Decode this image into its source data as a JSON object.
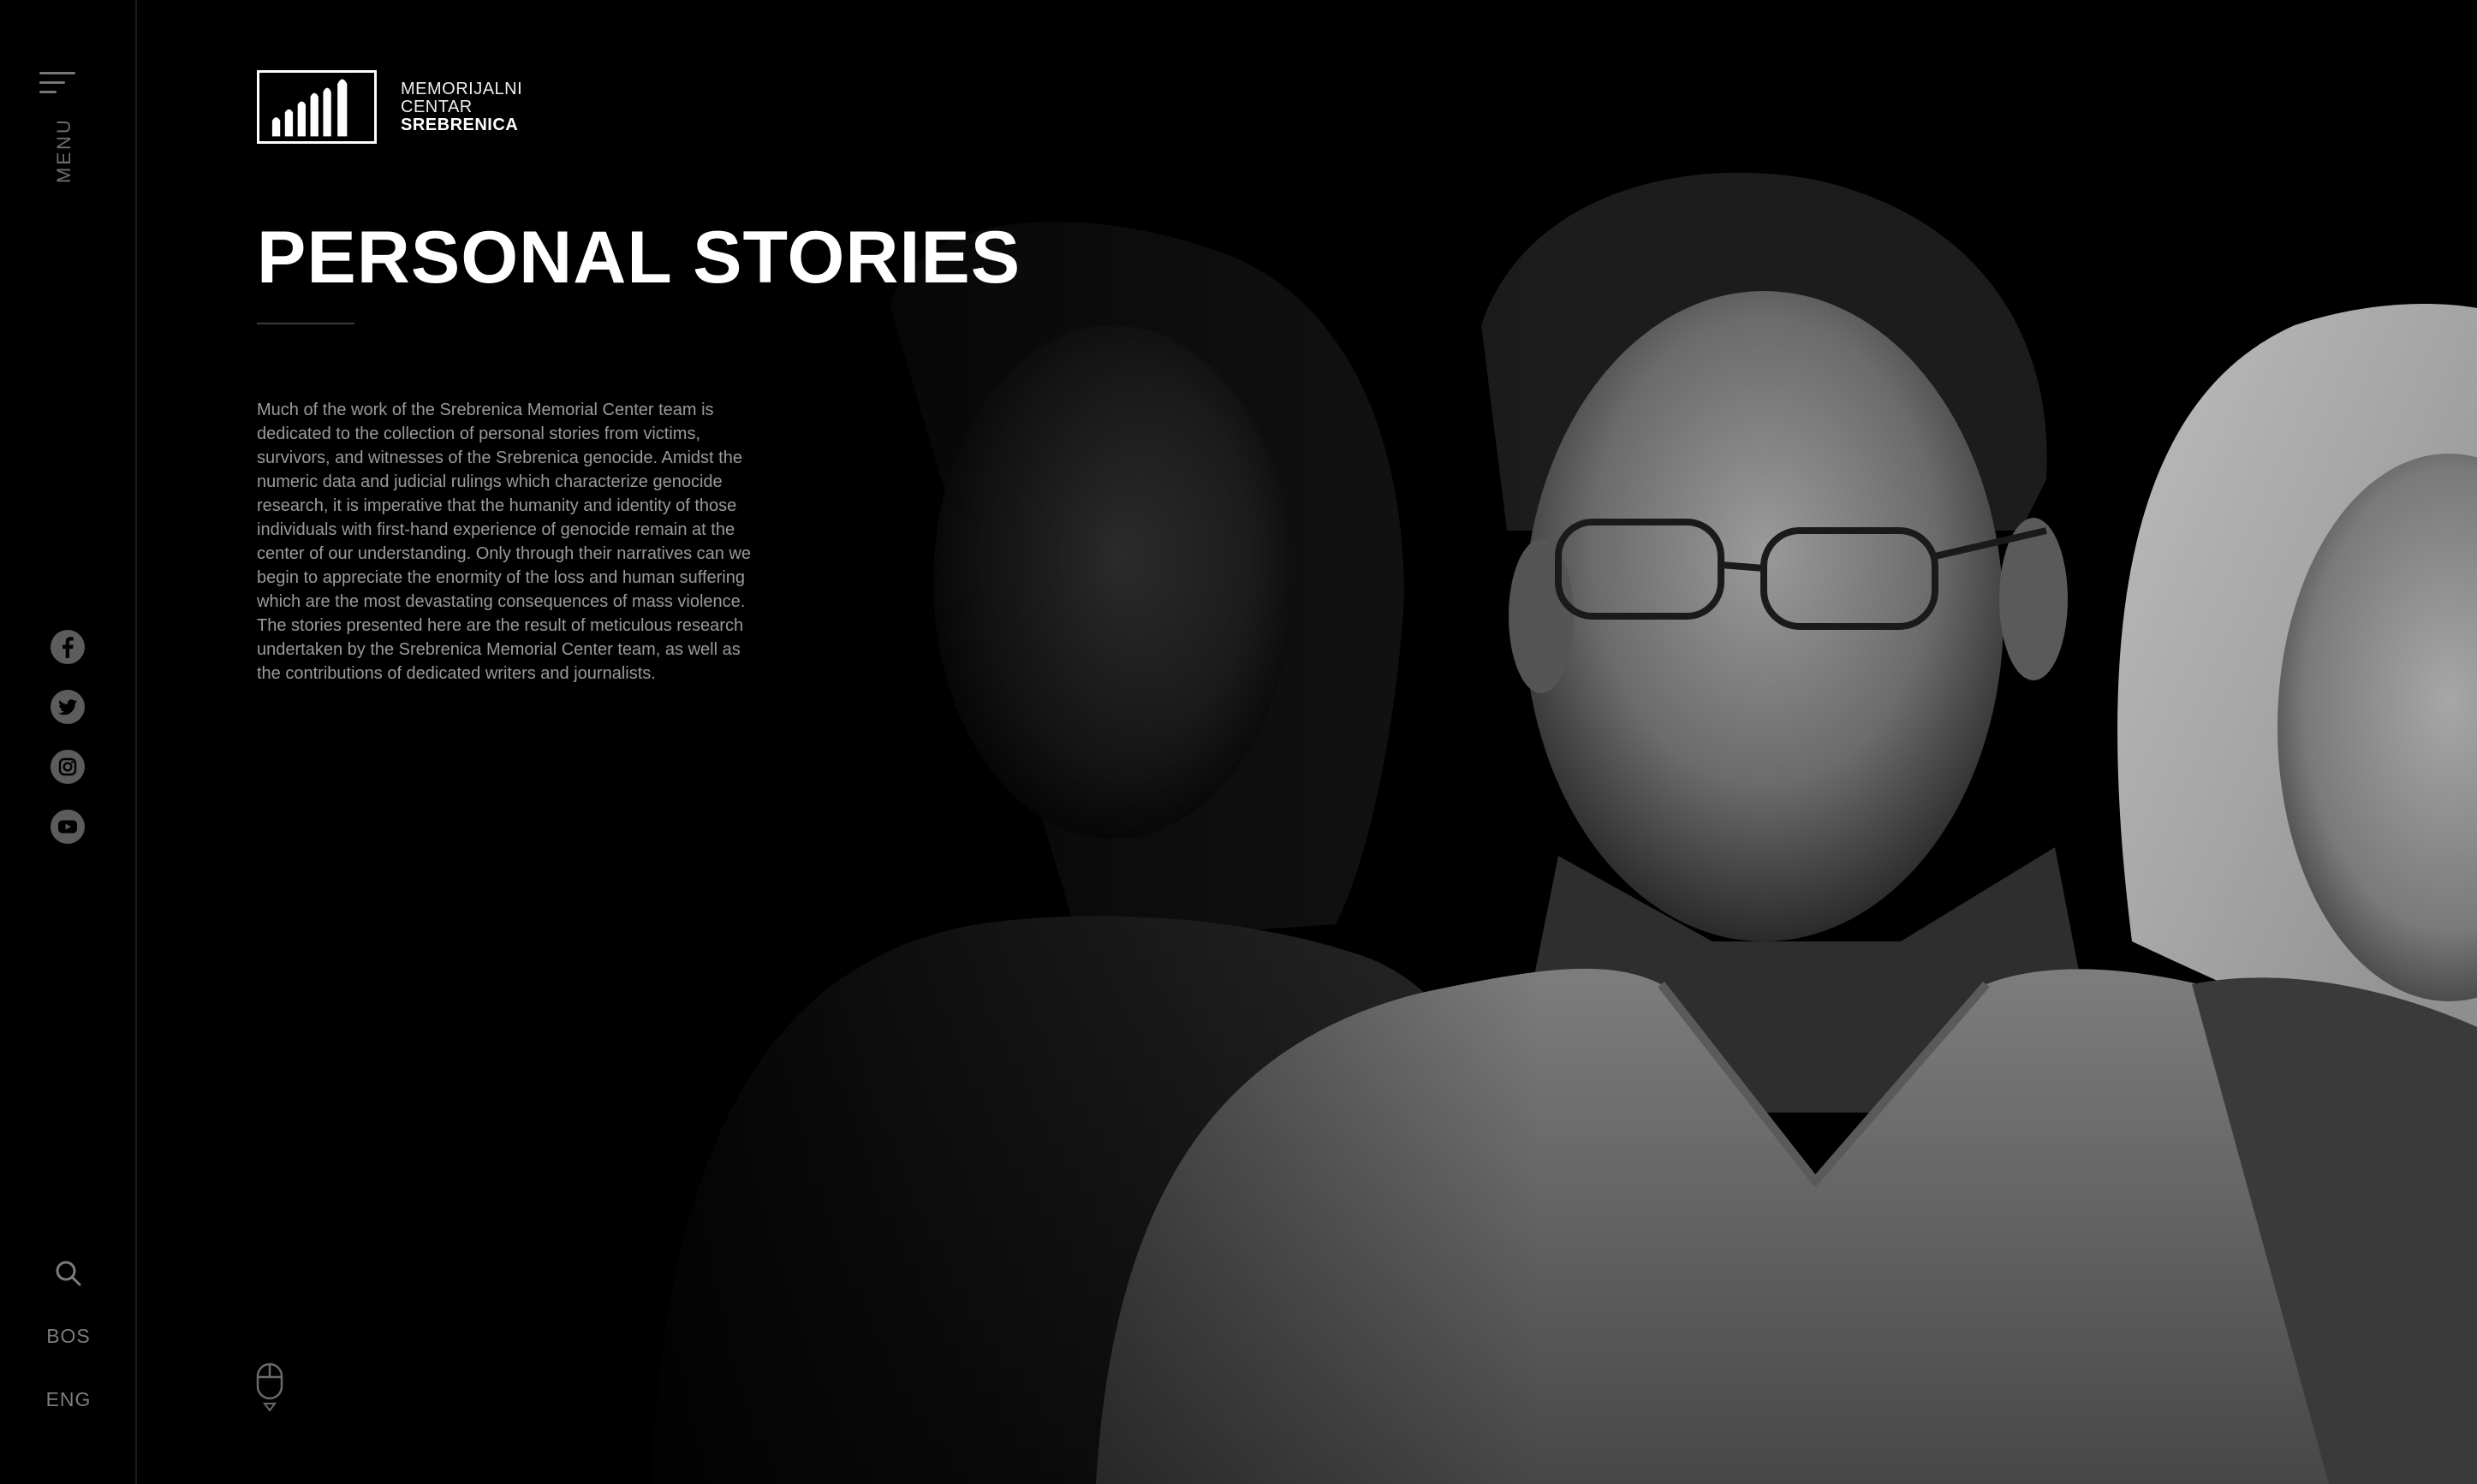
{
  "sidebar": {
    "menu_label": "MENU",
    "social": [
      {
        "name": "facebook-icon"
      },
      {
        "name": "twitter-icon"
      },
      {
        "name": "instagram-icon"
      },
      {
        "name": "youtube-icon"
      }
    ],
    "languages": [
      "BOS",
      "ENG"
    ]
  },
  "logo": {
    "line1": "MEMORIJALNI",
    "line2": "CENTAR",
    "line3": "SREBRENICA"
  },
  "page": {
    "title": "PERSONAL STORIES",
    "intro": "Much of the work of the Srebrenica Memorial Center team is dedicated to the collection of personal stories from victims, survivors, and witnesses of the Srebrenica genocide. Amidst the numeric data and judicial rulings which characterize genocide research, it is imperative that the humanity and identity of those individuals with first-hand experience of genocide remain at the center of our understanding. Only through their narratives can we begin to appreciate the enormity of the loss and human suffering which are the most devastating consequences of mass violence. The stories presented here are the result of meticulous research undertaken by the Srebrenica Memorial Center team, as well as the contributions of dedicated writers and journalists."
  },
  "colors": {
    "background": "#000000",
    "sidebar_text": "#7c7c7c",
    "body_text": "#9a9a9a",
    "title": "#ffffff"
  }
}
